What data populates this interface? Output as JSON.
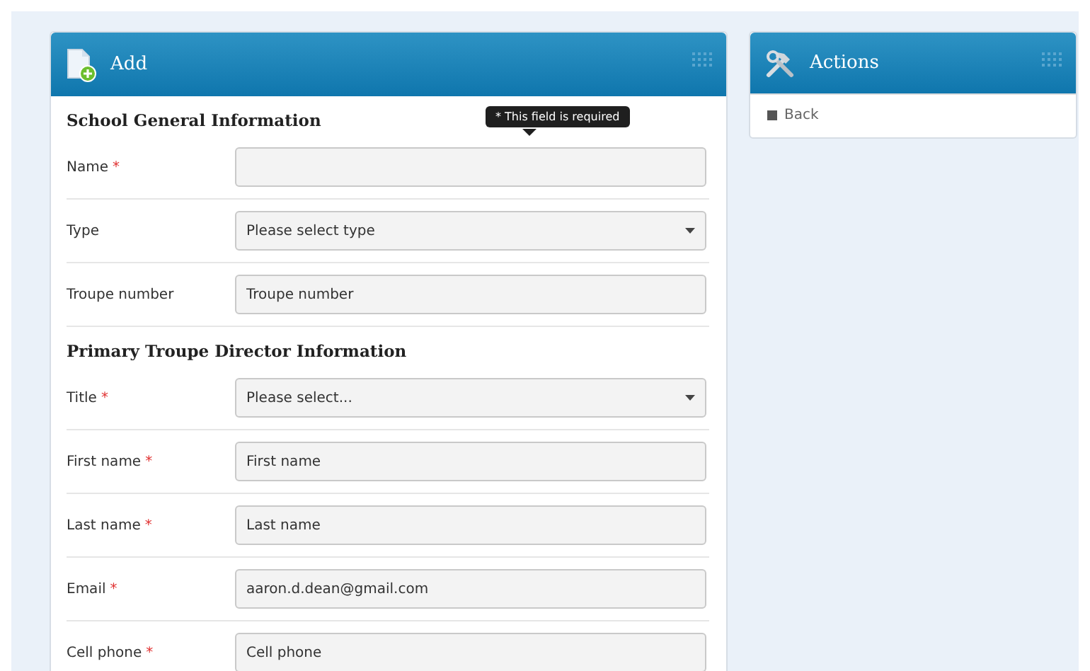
{
  "main_panel": {
    "title": "Add",
    "sections": [
      {
        "heading": "School General Information",
        "fields": [
          {
            "label": "Name",
            "mark": "*",
            "kind": "input",
            "tooltip": "* This field is required"
          },
          {
            "label": "Type",
            "kind": "select",
            "value": "Please select type"
          },
          {
            "label": "Troupe number",
            "kind": "input",
            "placeholder": "Troupe number"
          }
        ]
      },
      {
        "heading": "Primary Troupe Director Information",
        "fields": [
          {
            "label": "Title",
            "mark": "*",
            "kind": "select",
            "value": "Please select..."
          },
          {
            "label": "First name",
            "mark": "*",
            "kind": "input",
            "placeholder": "First name"
          },
          {
            "label": "Last name",
            "mark": "*",
            "kind": "input",
            "placeholder": "Last name"
          },
          {
            "label": "Email",
            "mark": "*",
            "kind": "input",
            "value": "aaron.d.dean@gmail.com"
          },
          {
            "label": "Cell phone",
            "mark": "*",
            "kind": "input",
            "placeholder": "Cell phone"
          }
        ]
      }
    ]
  },
  "actions_panel": {
    "title": "Actions",
    "items": [
      {
        "label": "Back"
      }
    ]
  }
}
